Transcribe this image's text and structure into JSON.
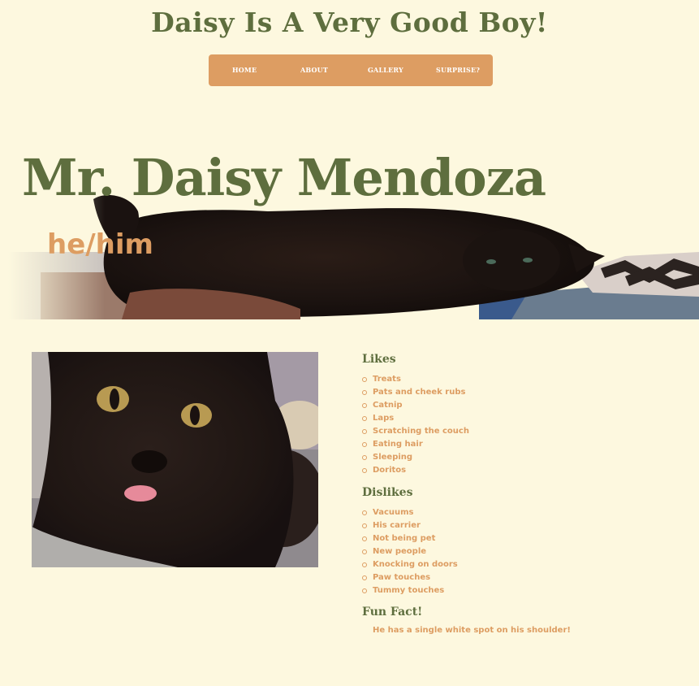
{
  "site": {
    "title": "Daisy Is A Very Good Boy!"
  },
  "nav": {
    "items": [
      {
        "label": "HOME"
      },
      {
        "label": "ABOUT"
      },
      {
        "label": "GALLERY"
      },
      {
        "label": "SURPRISE?"
      }
    ]
  },
  "hero": {
    "name": "Mr. Daisy Mendoza",
    "pronouns": "he/him"
  },
  "likes": {
    "heading": "Likes",
    "items": [
      "Treats",
      "Pats and cheek rubs",
      "Catnip",
      "Laps",
      "Scratching the couch",
      "Eating hair",
      "Sleeping",
      "Doritos"
    ]
  },
  "dislikes": {
    "heading": "Dislikes",
    "items": [
      "Vacuums",
      "His carrier",
      "Not being pet",
      "New people",
      "Knocking on doors",
      "Paw touches",
      "Tummy touches"
    ]
  },
  "fun_fact": {
    "heading": "Fun Fact!",
    "text": "He has a single white spot on his shoulder!"
  },
  "colors": {
    "background": "#fdf8df",
    "primary_green": "#5e6e3e",
    "accent_orange": "#dd9d62",
    "nav_text": "#ffffff"
  }
}
